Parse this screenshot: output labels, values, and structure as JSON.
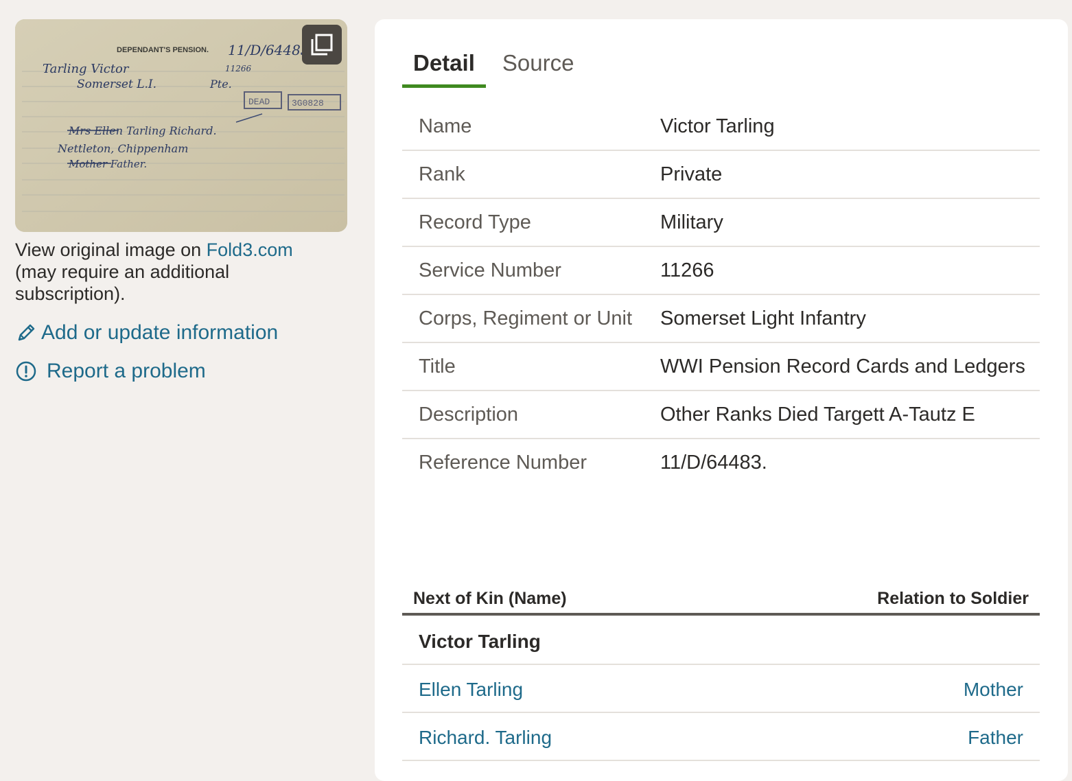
{
  "left": {
    "expand_icon": "expand-gallery-icon",
    "view_text_prefix": "View original image on ",
    "view_link": "Fold3.com",
    "view_text_suffix": " (may require an additional subscription).",
    "add_label": "Add or update information",
    "add_icon": "pencil-icon",
    "report_label": "Report a problem",
    "report_icon": "alert-circle-icon",
    "card": {
      "heading": "DEPENDANT'S PENSION.",
      "ref": "11/D/64483",
      "regimental_no": "11266",
      "stamp": "DEAD",
      "stamp_number": "3G0828",
      "name": "Tarling Victor",
      "regiment": "Somerset L.I.",
      "rank": "Pte.",
      "dependant": "Mrs Ellen Tarling Richard.",
      "address": "Nettleton, Chippenham",
      "relationship": "Mother Father."
    }
  },
  "tabs": [
    {
      "label": "Detail",
      "active": true
    },
    {
      "label": "Source",
      "active": false
    }
  ],
  "details": [
    {
      "label": "Name",
      "value": "Victor Tarling"
    },
    {
      "label": "Rank",
      "value": "Private"
    },
    {
      "label": "Record Type",
      "value": "Military"
    },
    {
      "label": "Service Number",
      "value": "11266"
    },
    {
      "label": "Corps, Regiment or Unit",
      "value": "Somerset Light Infantry"
    },
    {
      "label": "Title",
      "value": "WWI Pension Record Cards and Ledgers"
    },
    {
      "label": "Description",
      "value": "Other Ranks Died Targett A-Tautz E"
    },
    {
      "label": "Reference Number",
      "value": "11/D/64483."
    }
  ],
  "kin": {
    "col_name": "Next of Kin (Name)",
    "col_relation": "Relation to Soldier",
    "soldier": "Victor Tarling",
    "rows": [
      {
        "name": "Ellen Tarling",
        "relation": "Mother"
      },
      {
        "name": "Richard. Tarling",
        "relation": "Father"
      }
    ]
  },
  "colors": {
    "accent": "#3f8a20",
    "link": "#1e6a8a",
    "background": "#f3f0ed"
  }
}
